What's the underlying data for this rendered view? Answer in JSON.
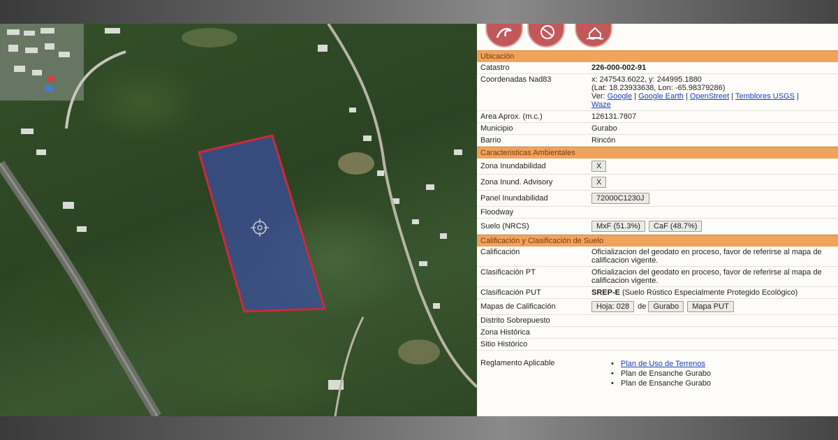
{
  "ubicacion": {
    "header": "Ubicación",
    "catastro_label": "Catastro",
    "catastro_value": "226-000-002-91",
    "coords_label": "Coordenadas Nad83",
    "coords_xy": "x: 247543.6022, y: 244995.1880",
    "coords_latlon": "(Lat: 18.23933638, Lon: -65.98379286)",
    "ver_label": "Ver:",
    "links": [
      "Google",
      "Google Earth",
      "OpenStreet",
      "Temblores USGS",
      "Waze"
    ],
    "area_label": "Area Aprox. (m.c.)",
    "area_value": "126131.7807",
    "municipio_label": "Municipio",
    "municipio_value": "Gurabo",
    "barrio_label": "Barrio",
    "barrio_value": "Rincón"
  },
  "ambientales": {
    "header": "Caracteristicas Ambientales",
    "zona_inund_label": "Zona Inundabilidad",
    "zona_inund_value": "X",
    "zona_adv_label": "Zona Inund. Advisory",
    "zona_adv_value": "X",
    "panel_label": "Panel Inundabilidad",
    "panel_value": "72000C1230J",
    "floodway_label": "Floodway",
    "suelo_label": "Suelo (NRCS)",
    "suelo_values": [
      "MxF (51.3%)",
      "CaF (48.7%)"
    ]
  },
  "calificacion": {
    "header": "Calificación y Clasificación de Suelo",
    "calif_label": "Calificación",
    "calif_value": "Oficializacion del geodato en proceso, favor de referirse al mapa de calificacion vigente.",
    "clasif_pt_label": "Clasificación PT",
    "clasif_pt_value": "Oficializacion del geodato en proceso, favor de referirse al mapa de calificacion vigente.",
    "clasif_put_label": "Clasificación PUT",
    "clasif_put_code": "SREP-E",
    "clasif_put_desc": "(Suelo Rústico Especialmente Protegido Ecológico)",
    "mapas_label": "Mapas de Calificación",
    "hoja_button": "Hoja: 028",
    "de_text": "de",
    "gurabo_button": "Gurabo",
    "mapa_put_button": "Mapa PUT",
    "distrito_label": "Distrito Sobrepuesto",
    "zona_hist_label": "Zona Histórica",
    "sitio_hist_label": "Sitio Histórico",
    "reglamento_label": "Reglamento Aplicable",
    "reglamentos": [
      "Plan de Uso de Terrenos",
      "Plan de Ensanche Gurabo",
      "Plan de Ensanche Gurabo"
    ]
  },
  "icons": [
    "tsunami-icon",
    "hazmat-icon",
    "flood-house-icon"
  ],
  "colors": {
    "section_bg": "#f2a35a",
    "parcel_stroke": "#d0283a",
    "parcel_fill": "#3b4fa0",
    "link": "#1a3fb8"
  }
}
